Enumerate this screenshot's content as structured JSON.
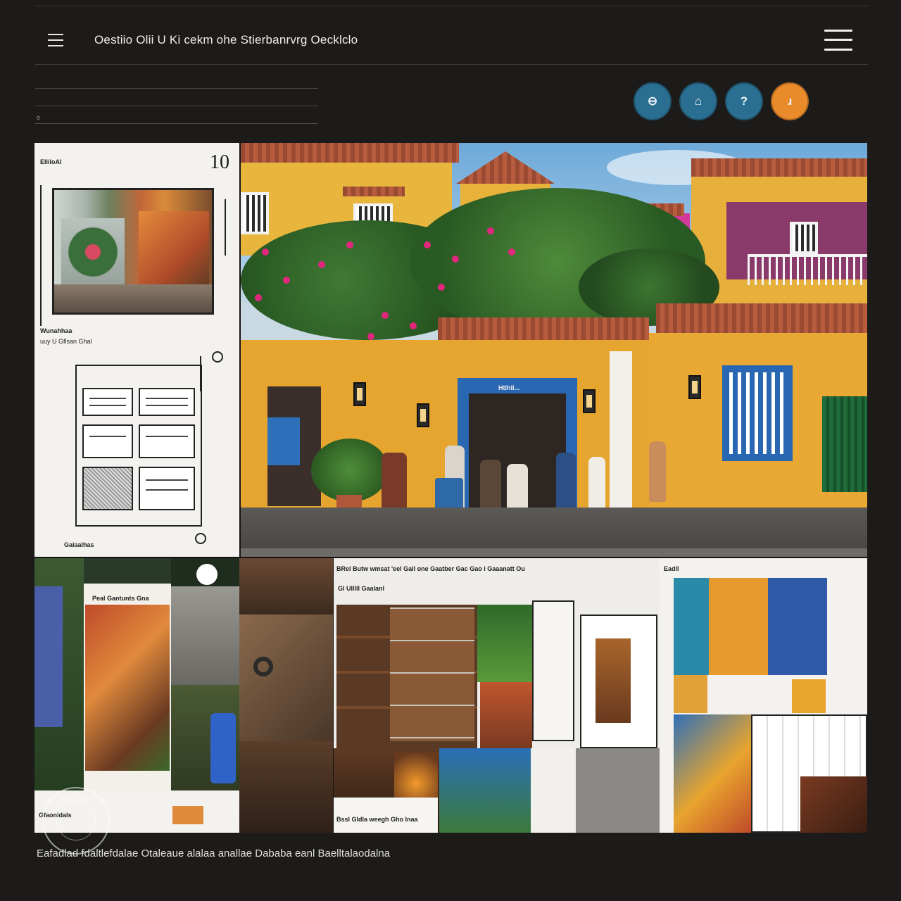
{
  "header": {
    "title": "Oestiio Olii U Ki cekm ohe Stierbanrvrg Oecklclo",
    "left_menu_icon": "hamburger-icon",
    "right_menu_icon": "hamburger-icon"
  },
  "subheader": {
    "marker": "o"
  },
  "circle_buttons": [
    {
      "glyph": "⊖",
      "color": "#2a6f92",
      "icon": "minus-icon"
    },
    {
      "glyph": "⌂",
      "color": "#2a6f92",
      "icon": "home-icon"
    },
    {
      "glyph": "?",
      "color": "#2a6f92",
      "icon": "help-icon"
    },
    {
      "glyph": "ɹ",
      "color": "#e98a2b",
      "icon": "action-icon"
    }
  ],
  "plan_panel": {
    "number": "10",
    "label_top": "ElliloAI",
    "label_mid_1": "Wunahhaa",
    "label_mid_2": "uuy U Gflsan Ghal",
    "label_bottom": "Gaiaalhas"
  },
  "street_photo": {
    "shop_sign": "Htlhll..."
  },
  "bottom_row": {
    "b1_header": "Peal Gantunts Gna",
    "b1_footer": "Gfaonldals",
    "b3_header": "BRel Butw wmsat 'eel Gall one Gaatber Gac Gao i Gaaanatt Ou",
    "b3_sub": "Gl Ulllll Gaalanl",
    "b3_footer": "Bssl Gldla weegh Gho lnaa",
    "b4_header": "Eadll"
  },
  "caption": "Eafadlad fdaltlefdalae Otaleaue alalaa anallae Dababa eanl Baelltalaodalna",
  "watermark": "IMAGINED WITH AI",
  "colors": {
    "background": "#1c1b1a",
    "accent_blue": "#2a6f92",
    "accent_orange": "#e98a2b"
  }
}
